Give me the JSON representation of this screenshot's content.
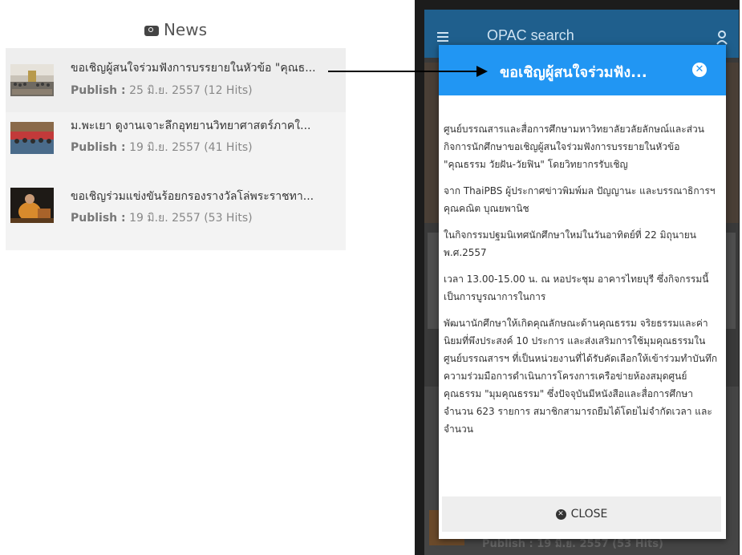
{
  "news": {
    "header": "News",
    "items": [
      {
        "title": "ขอเชิญผู้สนใจร่วมฟังการบรรยายในหัวข้อ \"คุณธ...",
        "meta_label": "Publish :",
        "meta_value": "25 มิ.ย. 2557 (12 Hits)"
      },
      {
        "title": "ม.พะเยา ดูงานเจาะลึกอุทยานวิทยาศาสตร์ภาคใ...",
        "meta_label": "Publish :",
        "meta_value": "19 มิ.ย. 2557 (41 Hits)"
      },
      {
        "title": "ขอเชิญร่วมแข่งขันร้อยกรองรางวัลโล่พระราชทา...",
        "meta_label": "Publish :",
        "meta_value": "19 มิ.ย. 2557 (53 Hits)"
      }
    ]
  },
  "app": {
    "title": "OPAC search",
    "background_meta": "Publish : 19 มิ.ย. 2557 (53 Hits)"
  },
  "modal": {
    "title": "ขอเชิญผู้สนใจร่วมฟัง...",
    "paragraphs": [
      "ศูนย์บรรณสารและสื่อการศึกษามหาวิทยาลัยวลัยลักษณ์และส่วนกิจการนักศึกษาขอเชิญผู้สนใจร่วมฟังการบรรยายในหัวข้อ \"คุณธรรม วัยฝัน-วัยฟิน\" โดยวิทยากรรับเชิญ",
      "จาก ThaiPBS ผู้ประกาศข่าวพิมพ์มล ปัญญานะ และบรรณาธิการฯ คุณคณิต บุณยพานิช",
      "ในกิจกรรมปฐมนิเทศนักศึกษาใหม่ในวันอาทิตย์ที่ 22 มิถุนายน พ.ศ.2557",
      "เวลา 13.00-15.00 น. ณ หอประชุม อาคารไทยบุรี ซึ่งกิจกรรมนี้เป็นการบูรณาการในการ",
      "พัฒนานักศึกษาให้เกิดคุณลักษณะด้านคุณธรรม จริยธรรมและค่านิยมที่พึงประสงค์ 10 ประการ และส่งเสริมการใช้มุมคุณธรรมในศูนย์บรรณสารฯ ที่เป็นหน่วยงานที่ได้รับคัดเลือกให้เข้าร่วมทำบันทึกความร่วมมือการดำเนินการโครงการเครือข่ายห้องสมุดศูนย์คุณธรรม \"มุมคุณธรรม\" ซึ่งปัจจุบันมีหนังสือและสื่อการศึกษาจำนวน 623 รายการ สมาชิกสามารถยืมได้โดยไม่จำกัดเวลา และจำนวน"
    ],
    "close_label": "CLOSE"
  },
  "colors": {
    "modal_header": "#2196f3",
    "appbar": "#1f5f8d"
  }
}
